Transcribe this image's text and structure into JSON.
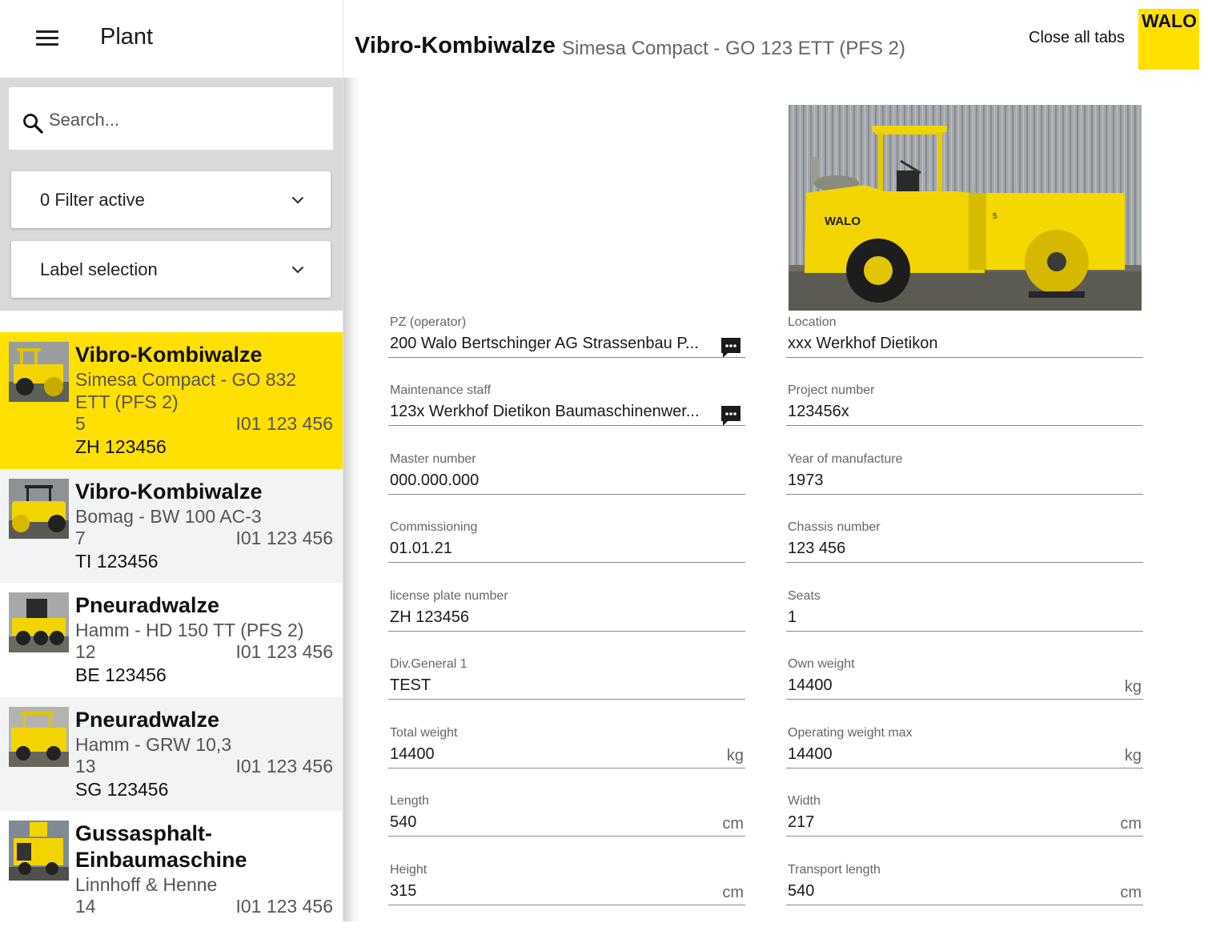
{
  "sidebar": {
    "title": "Plant",
    "search_placeholder": "Search...",
    "filter_label": "0 Filter active",
    "label_selection": "Label selection",
    "items": [
      {
        "name": "Vibro-Kombiwalze",
        "model": "Simesa Compact - GO 832 ETT (PFS 2)",
        "number": "5",
        "inventory": "I01 123 456",
        "plate": "ZH 123456",
        "selected": true
      },
      {
        "name": "Vibro-Kombiwalze",
        "model": "Bomag - BW 100 AC-3",
        "number": "7",
        "inventory": "I01 123 456",
        "plate": "TI 123456"
      },
      {
        "name": "Pneuradwalze",
        "model": "Hamm - HD 150 TT (PFS 2)",
        "number": "12",
        "inventory": "I01 123 456",
        "plate": "BE 123456"
      },
      {
        "name": "Pneuradwalze",
        "model": "Hamm - GRW 10,3",
        "number": "13",
        "inventory": "I01 123 456",
        "plate": "SG 123456"
      },
      {
        "name": "Gussasphalt-Einbaumaschine",
        "model": "Linnhoff & Henne",
        "number": "14",
        "inventory": "I01 123 456",
        "plate": ""
      }
    ]
  },
  "header": {
    "title": "Vibro-Kombiwalze",
    "subtitle": "Simesa Compact - GO 123 ETT (PFS 2)",
    "close_all": "Close all tabs",
    "logo_text": "WALO"
  },
  "photo": {
    "roller_label": "WALO",
    "number_plate": "5"
  },
  "details": {
    "left": [
      {
        "label": "PZ (operator)",
        "value": "200 Walo Bertschinger AG Strassenbau P...",
        "unit": "",
        "chat": true
      },
      {
        "label": "Maintenance staff",
        "value": "123x Werkhof Dietikon Baumaschinenwer...",
        "unit": "",
        "chat": true
      },
      {
        "label": "Master number",
        "value": "000.000.000",
        "unit": ""
      },
      {
        "label": "Commissioning",
        "value": "01.01.21",
        "unit": ""
      },
      {
        "label": "license plate number",
        "value": "ZH 123456",
        "unit": ""
      },
      {
        "label": "Div.General 1",
        "value": "TEST",
        "unit": ""
      },
      {
        "label": "Total weight",
        "value": "14400",
        "unit": "kg"
      },
      {
        "label": "Length",
        "value": "540",
        "unit": "cm"
      },
      {
        "label": "Height",
        "value": "315",
        "unit": "cm"
      }
    ],
    "right": [
      {
        "label": "Location",
        "value": "xxx Werkhof Dietikon",
        "unit": ""
      },
      {
        "label": "Project number",
        "value": "123456x",
        "unit": ""
      },
      {
        "label": "Year of manufacture",
        "value": "1973",
        "unit": ""
      },
      {
        "label": "Chassis number",
        "value": "123 456",
        "unit": ""
      },
      {
        "label": "Seats",
        "value": "1",
        "unit": ""
      },
      {
        "label": "Own weight",
        "value": "14400",
        "unit": "kg"
      },
      {
        "label": "Operating weight max",
        "value": "14400",
        "unit": "kg"
      },
      {
        "label": "Width",
        "value": "217",
        "unit": "cm"
      },
      {
        "label": "Transport length",
        "value": "540",
        "unit": "cm"
      }
    ]
  },
  "colors": {
    "accent": "#ffe000",
    "sidebar_bg": "#d9d9d9",
    "alt_row": "#f2f3f5"
  }
}
